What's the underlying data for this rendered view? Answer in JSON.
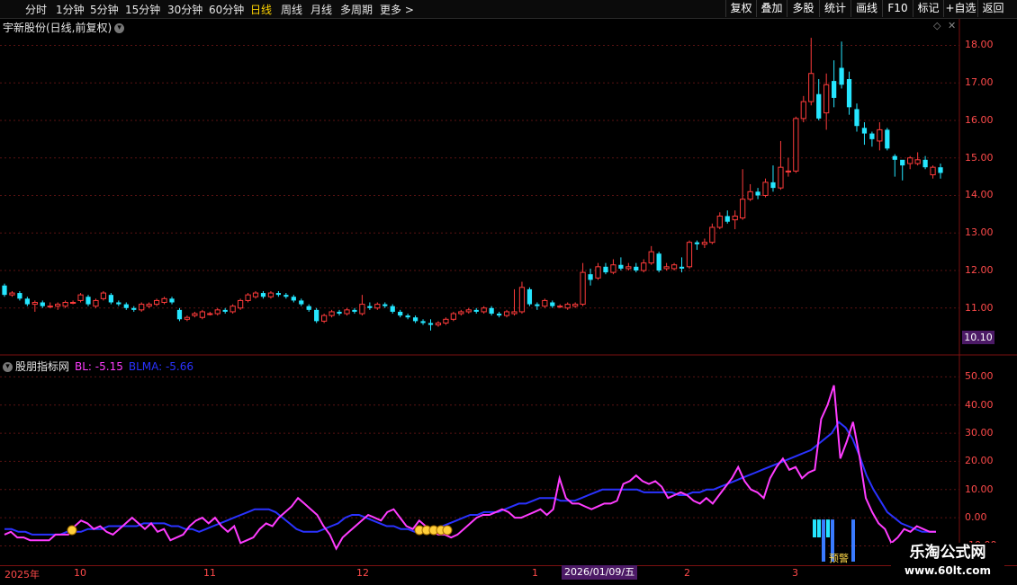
{
  "toolbar": {
    "periods": [
      "分时",
      "1分钟",
      "5分钟",
      "15分钟",
      "30分钟",
      "60分钟",
      "日线",
      "周线",
      "月线",
      "多周期",
      "更多 >"
    ],
    "active": "日线",
    "right_buttons": [
      "复权",
      "叠加",
      "多股",
      "统计",
      "画线",
      "F10",
      "标记",
      "+自选",
      "返回"
    ]
  },
  "main_chart": {
    "title": "宇新股份(日线,前复权)",
    "price_axis": [
      "18.00",
      "17.00",
      "16.00",
      "15.00",
      "14.00",
      "13.00",
      "12.00",
      "11.00"
    ],
    "current_price": "10.10"
  },
  "indicator": {
    "name": "股朋指标网",
    "bl_label": "BL: -5.15",
    "blma_label": "BLMA: -5.66",
    "axis": [
      "50.00",
      "40.00",
      "30.00",
      "20.00",
      "10.00",
      "0.00",
      "-10.00"
    ],
    "warning_label": "预警"
  },
  "date_axis": {
    "labels": [
      "2025年",
      "10",
      "11",
      "12",
      "1",
      "2",
      "3"
    ],
    "cursor_date": "2026/01/09/五"
  },
  "watermark": {
    "line1": "乐淘公式网",
    "line2": "www.60lt.com"
  },
  "colors": {
    "up": "#ff3b3b",
    "down": "#25e6ff",
    "bl": "#ff3cff",
    "blma": "#2a32ff",
    "bg": "#000000",
    "grid": "#5a1212"
  },
  "chart_data": {
    "type": "candlestick",
    "candles": [
      [
        11.6,
        11.35,
        11.65,
        11.3
      ],
      [
        11.35,
        11.4,
        11.45,
        11.3
      ],
      [
        11.4,
        11.25,
        11.45,
        11.2
      ],
      [
        11.25,
        11.1,
        11.3,
        11.05
      ],
      [
        11.1,
        11.15,
        11.2,
        10.9
      ],
      [
        11.15,
        11.05,
        11.2,
        11.0
      ],
      [
        11.05,
        11.05,
        11.15,
        11.0
      ],
      [
        11.05,
        11.1,
        11.15,
        10.95
      ],
      [
        11.05,
        11.15,
        11.2,
        11.0
      ],
      [
        11.15,
        11.15,
        11.2,
        11.1
      ],
      [
        11.2,
        11.35,
        11.4,
        11.15
      ],
      [
        11.3,
        11.1,
        11.35,
        11.05
      ],
      [
        11.05,
        11.2,
        11.25,
        11.0
      ],
      [
        11.25,
        11.4,
        11.45,
        11.2
      ],
      [
        11.35,
        11.15,
        11.4,
        11.1
      ],
      [
        11.15,
        11.1,
        11.2,
        11.05
      ],
      [
        11.1,
        11.0,
        11.15,
        10.95
      ],
      [
        11.0,
        10.95,
        11.05,
        10.9
      ],
      [
        10.95,
        11.1,
        11.15,
        10.9
      ],
      [
        11.05,
        11.1,
        11.15,
        11.0
      ],
      [
        11.1,
        11.2,
        11.25,
        11.05
      ],
      [
        11.15,
        11.25,
        11.3,
        11.1
      ],
      [
        11.25,
        11.15,
        11.3,
        11.1
      ],
      [
        10.95,
        10.7,
        11.0,
        10.65
      ],
      [
        10.7,
        10.75,
        10.8,
        10.65
      ],
      [
        10.8,
        10.85,
        10.9,
        10.75
      ],
      [
        10.75,
        10.9,
        10.95,
        10.7
      ],
      [
        10.85,
        10.85,
        10.9,
        10.8
      ],
      [
        10.85,
        10.95,
        11.0,
        10.8
      ],
      [
        10.95,
        10.9,
        11.0,
        10.85
      ],
      [
        10.9,
        11.05,
        11.1,
        10.85
      ],
      [
        11.0,
        11.2,
        11.25,
        10.95
      ],
      [
        11.2,
        11.35,
        11.4,
        11.15
      ],
      [
        11.3,
        11.4,
        11.45,
        11.25
      ],
      [
        11.4,
        11.3,
        11.45,
        11.25
      ],
      [
        11.3,
        11.4,
        11.45,
        11.25
      ],
      [
        11.4,
        11.35,
        11.45,
        11.3
      ],
      [
        11.35,
        11.3,
        11.4,
        11.25
      ],
      [
        11.3,
        11.2,
        11.35,
        11.15
      ],
      [
        11.2,
        11.1,
        11.25,
        11.05
      ],
      [
        11.05,
        10.95,
        11.1,
        10.9
      ],
      [
        10.95,
        10.65,
        11.0,
        10.6
      ],
      [
        10.65,
        10.8,
        10.85,
        10.6
      ],
      [
        10.8,
        10.9,
        10.95,
        10.75
      ],
      [
        10.9,
        10.85,
        10.95,
        10.8
      ],
      [
        10.85,
        10.95,
        11.0,
        10.8
      ],
      [
        10.95,
        10.9,
        11.0,
        10.85
      ],
      [
        10.85,
        11.1,
        11.35,
        10.8
      ],
      [
        11.05,
        11.0,
        11.15,
        10.95
      ],
      [
        11.0,
        11.1,
        11.15,
        10.95
      ],
      [
        11.1,
        11.05,
        11.15,
        11.0
      ],
      [
        11.05,
        10.9,
        11.1,
        10.85
      ],
      [
        10.9,
        10.8,
        10.95,
        10.75
      ],
      [
        10.8,
        10.75,
        10.85,
        10.7
      ],
      [
        10.75,
        10.65,
        10.8,
        10.6
      ],
      [
        10.65,
        10.6,
        10.7,
        10.55
      ],
      [
        10.6,
        10.55,
        10.7,
        10.4
      ],
      [
        10.55,
        10.6,
        10.65,
        10.5
      ],
      [
        10.6,
        10.7,
        10.75,
        10.55
      ],
      [
        10.7,
        10.85,
        10.9,
        10.65
      ],
      [
        10.85,
        10.9,
        10.95,
        10.8
      ],
      [
        10.9,
        10.95,
        11.0,
        10.85
      ],
      [
        10.95,
        10.9,
        11.0,
        10.85
      ],
      [
        10.9,
        11.0,
        11.05,
        10.85
      ],
      [
        11.0,
        10.85,
        11.05,
        10.8
      ],
      [
        10.85,
        10.8,
        10.9,
        10.75
      ],
      [
        10.8,
        10.9,
        10.95,
        10.75
      ],
      [
        10.85,
        10.9,
        11.5,
        10.8
      ],
      [
        10.9,
        11.55,
        11.7,
        10.85
      ],
      [
        11.5,
        11.1,
        11.55,
        11.05
      ],
      [
        11.1,
        11.05,
        11.15,
        10.95
      ],
      [
        11.05,
        11.2,
        11.25,
        11.0
      ],
      [
        11.15,
        11.05,
        11.2,
        11.0
      ],
      [
        11.05,
        11.05,
        11.1,
        11.0
      ],
      [
        11.0,
        11.1,
        11.15,
        10.95
      ],
      [
        11.05,
        11.1,
        11.15,
        11.0
      ],
      [
        11.1,
        11.95,
        12.2,
        11.05
      ],
      [
        11.9,
        11.75,
        12.05,
        11.6
      ],
      [
        11.8,
        12.1,
        12.2,
        11.75
      ],
      [
        12.1,
        11.95,
        12.2,
        11.9
      ],
      [
        11.95,
        12.15,
        12.3,
        11.9
      ],
      [
        12.15,
        12.05,
        12.35,
        12.0
      ],
      [
        12.05,
        12.1,
        12.2,
        12.0
      ],
      [
        12.1,
        12.0,
        12.2,
        11.95
      ],
      [
        12.0,
        12.2,
        12.3,
        11.95
      ],
      [
        12.2,
        12.5,
        12.65,
        12.15
      ],
      [
        12.45,
        12.0,
        12.5,
        11.95
      ],
      [
        12.05,
        12.1,
        12.2,
        12.0
      ],
      [
        12.05,
        12.15,
        12.2,
        12.0
      ],
      [
        12.1,
        12.05,
        12.35,
        11.95
      ],
      [
        12.1,
        12.75,
        12.8,
        12.05
      ],
      [
        12.75,
        12.7,
        12.8,
        12.55
      ],
      [
        12.7,
        12.75,
        12.85,
        12.6
      ],
      [
        12.75,
        13.15,
        13.25,
        12.7
      ],
      [
        13.15,
        13.45,
        13.55,
        13.1
      ],
      [
        13.45,
        13.3,
        13.6,
        13.25
      ],
      [
        13.35,
        13.45,
        13.6,
        13.1
      ],
      [
        13.4,
        13.9,
        14.7,
        13.35
      ],
      [
        13.9,
        14.1,
        14.3,
        13.85
      ],
      [
        14.1,
        14.0,
        14.2,
        13.9
      ],
      [
        14.0,
        14.35,
        14.45,
        13.95
      ],
      [
        14.35,
        14.2,
        14.8,
        14.1
      ],
      [
        14.2,
        14.75,
        15.45,
        14.15
      ],
      [
        14.65,
        14.65,
        15.0,
        14.5
      ],
      [
        14.65,
        16.05,
        16.1,
        14.6
      ],
      [
        16.05,
        16.5,
        16.65,
        15.95
      ],
      [
        16.5,
        17.25,
        18.2,
        16.4
      ],
      [
        16.7,
        16.05,
        17.1,
        16.0
      ],
      [
        16.2,
        16.95,
        17.25,
        15.75
      ],
      [
        17.05,
        16.6,
        17.6,
        16.35
      ],
      [
        17.4,
        16.95,
        18.1,
        16.85
      ],
      [
        17.1,
        16.35,
        17.3,
        16.15
      ],
      [
        16.3,
        15.85,
        16.45,
        15.7
      ],
      [
        15.8,
        15.65,
        15.95,
        15.35
      ],
      [
        15.65,
        15.5,
        15.7,
        15.3
      ],
      [
        15.45,
        15.75,
        15.95,
        15.2
      ],
      [
        15.75,
        15.25,
        15.8,
        15.2
      ],
      [
        15.05,
        14.95,
        15.1,
        14.5
      ],
      [
        14.95,
        14.8,
        14.9,
        14.4
      ],
      [
        14.85,
        15.0,
        15.05,
        14.7
      ],
      [
        14.85,
        14.95,
        15.15,
        14.8
      ],
      [
        14.95,
        14.75,
        15.05,
        14.7
      ],
      [
        14.55,
        14.75,
        14.8,
        14.45
      ],
      [
        14.75,
        14.6,
        14.85,
        14.45
      ]
    ],
    "bl": [
      -6,
      -5,
      -7,
      -7,
      -8,
      -8,
      -8,
      -8,
      -6,
      -6,
      -6,
      -3,
      -1,
      -2,
      -4,
      -3,
      -5,
      -6,
      -4,
      -2,
      0,
      -2,
      -4,
      -2,
      -5,
      -4,
      -8,
      -7,
      -6,
      -3,
      -1,
      0,
      -2,
      0,
      -3,
      -5,
      -3,
      -9,
      -8,
      -7,
      -4,
      -2,
      -3,
      0,
      2,
      4,
      7,
      5,
      3,
      1,
      -3,
      -6,
      -11,
      -7,
      -5,
      -3,
      -1,
      1,
      0,
      -1,
      2,
      3,
      0,
      -3,
      -4,
      -1,
      -3,
      -5,
      -6,
      -6,
      -7,
      -6,
      -4,
      -2,
      0,
      1,
      1,
      2,
      3,
      2,
      0,
      0,
      1,
      2,
      3,
      1,
      3,
      14,
      7,
      5,
      5,
      4,
      3,
      4,
      5,
      5,
      6,
      12,
      13,
      15,
      13,
      12,
      13,
      11,
      7,
      8,
      9,
      8,
      6,
      5,
      7,
      5,
      8,
      11,
      14,
      18,
      13,
      10,
      9,
      7,
      14,
      18,
      21,
      17,
      18,
      14,
      16,
      17,
      35,
      40,
      47,
      21,
      27,
      34,
      22,
      7,
      2,
      -2,
      -4,
      -9,
      -7,
      -4,
      -5,
      -3,
      -4,
      -5,
      -5
    ],
    "blma": [
      -4,
      -4,
      -5,
      -5,
      -6,
      -6,
      -6,
      -6,
      -6,
      -5,
      -5,
      -5,
      -4,
      -4,
      -4,
      -3,
      -3,
      -3,
      -3,
      -3,
      -2,
      -2,
      -2,
      -2,
      -3,
      -3,
      -4,
      -4,
      -5,
      -4,
      -3,
      -2,
      -1,
      0,
      1,
      2,
      3,
      3,
      3,
      2,
      0,
      -2,
      -4,
      -5,
      -5,
      -5,
      -4,
      -3,
      -2,
      0,
      1,
      1,
      0,
      -1,
      -2,
      -3,
      -3,
      -4,
      -4,
      -5,
      -5,
      -5,
      -4,
      -3,
      -2,
      -1,
      0,
      1,
      1,
      2,
      2,
      2,
      3,
      4,
      5,
      5,
      6,
      7,
      7,
      7,
      6,
      6,
      6,
      7,
      8,
      9,
      10,
      10,
      10,
      10,
      10,
      10,
      9,
      9,
      9,
      9,
      9,
      8,
      8,
      9,
      9,
      10,
      10,
      11,
      12,
      13,
      14,
      15,
      16,
      17,
      18,
      19,
      20,
      21,
      22,
      23,
      24,
      26,
      28,
      30,
      34,
      32,
      28,
      22,
      15,
      10,
      6,
      2,
      0,
      -2,
      -3,
      -4,
      -5,
      -5,
      -5
    ]
  }
}
